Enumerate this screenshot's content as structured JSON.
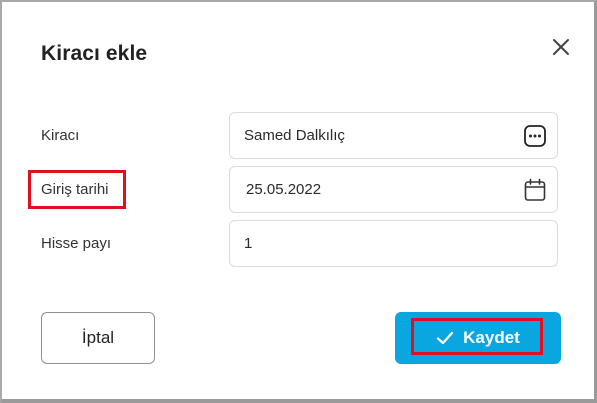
{
  "dialog": {
    "title": "Kiracı ekle",
    "close_icon": "close-icon"
  },
  "form": {
    "tenant": {
      "label": "Kiracı",
      "value": "Samed Dalkılıç",
      "icon": "more-options-icon"
    },
    "entry_date": {
      "label": "Giriş tarihi",
      "value": "25.05.2022",
      "icon": "calendar-icon"
    },
    "share": {
      "label": "Hisse payı",
      "value": "1"
    }
  },
  "actions": {
    "cancel_label": "İptal",
    "save_label": "Kaydet",
    "save_icon": "check-icon"
  },
  "colors": {
    "primary": "#0aa6df",
    "highlight": "#e01020",
    "text": "#333333"
  }
}
